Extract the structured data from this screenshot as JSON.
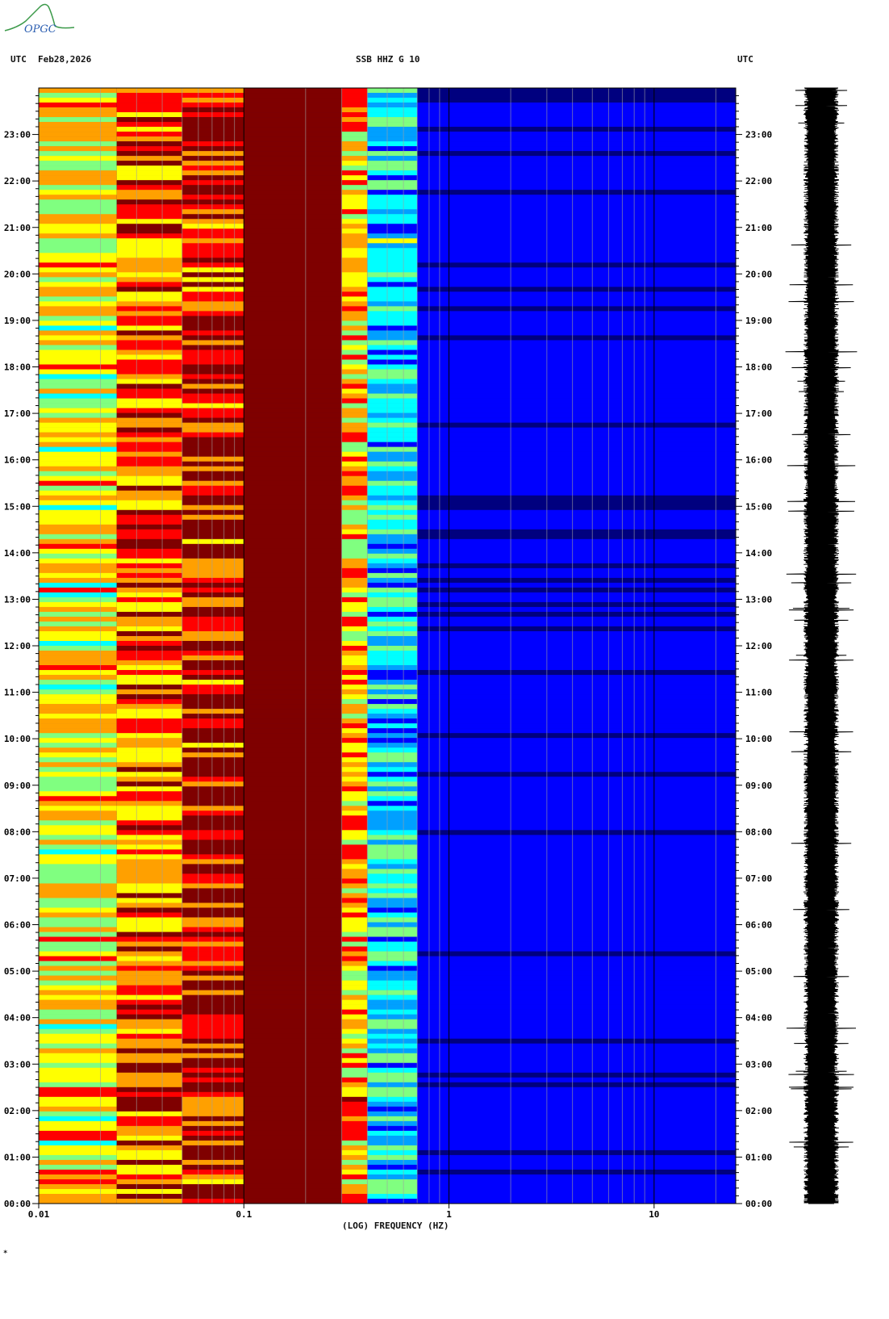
{
  "header": {
    "left_label": "UTC",
    "date": "Feb28,2026",
    "station": "SSB HHZ G 10",
    "right_label": "UTC"
  },
  "logo": {
    "text": "OPGC",
    "color": "#2a5db0",
    "accent": "#3c9a4a"
  },
  "footer": {
    "mark": "*"
  },
  "chart_data": {
    "type": "heatmap",
    "title": "SSB HHZ G 10",
    "xlabel": "(LOG) FREQUENCY (HZ)",
    "ylabel": "",
    "x_scale": "log",
    "xlim": [
      0.01,
      25
    ],
    "x_ticks": [
      0.01,
      0.1,
      1,
      10
    ],
    "x_tick_labels": [
      "0.01",
      "0.1",
      "1",
      "10"
    ],
    "ylim_hours": [
      0,
      24
    ],
    "y_tick_labels": [
      "00:00",
      "01:00",
      "02:00",
      "03:00",
      "04:00",
      "05:00",
      "06:00",
      "07:00",
      "08:00",
      "09:00",
      "10:00",
      "11:00",
      "12:00",
      "13:00",
      "14:00",
      "15:00",
      "16:00",
      "17:00",
      "18:00",
      "19:00",
      "20:00",
      "21:00",
      "22:00",
      "23:00"
    ],
    "colormap": [
      "#00007f",
      "#0000ff",
      "#00a0ff",
      "#00ffff",
      "#80ff80",
      "#ffff00",
      "#ffa000",
      "#ff0000",
      "#7f0000"
    ],
    "bands": [
      {
        "f_from": 0.01,
        "f_to": 0.024,
        "level": 0.62
      },
      {
        "f_from": 0.024,
        "f_to": 0.05,
        "level": 0.8
      },
      {
        "f_from": 0.05,
        "f_to": 0.1,
        "level": 0.9
      },
      {
        "f_from": 0.1,
        "f_to": 0.3,
        "level": 1.0
      },
      {
        "f_from": 0.3,
        "f_to": 0.4,
        "level": 0.72
      },
      {
        "f_from": 0.4,
        "f_to": 0.7,
        "level": 0.35
      },
      {
        "f_from": 0.7,
        "f_to": 25,
        "level": 0.05
      }
    ],
    "seismogram": {
      "color": "#000000",
      "hours": [
        0,
        24
      ]
    }
  }
}
